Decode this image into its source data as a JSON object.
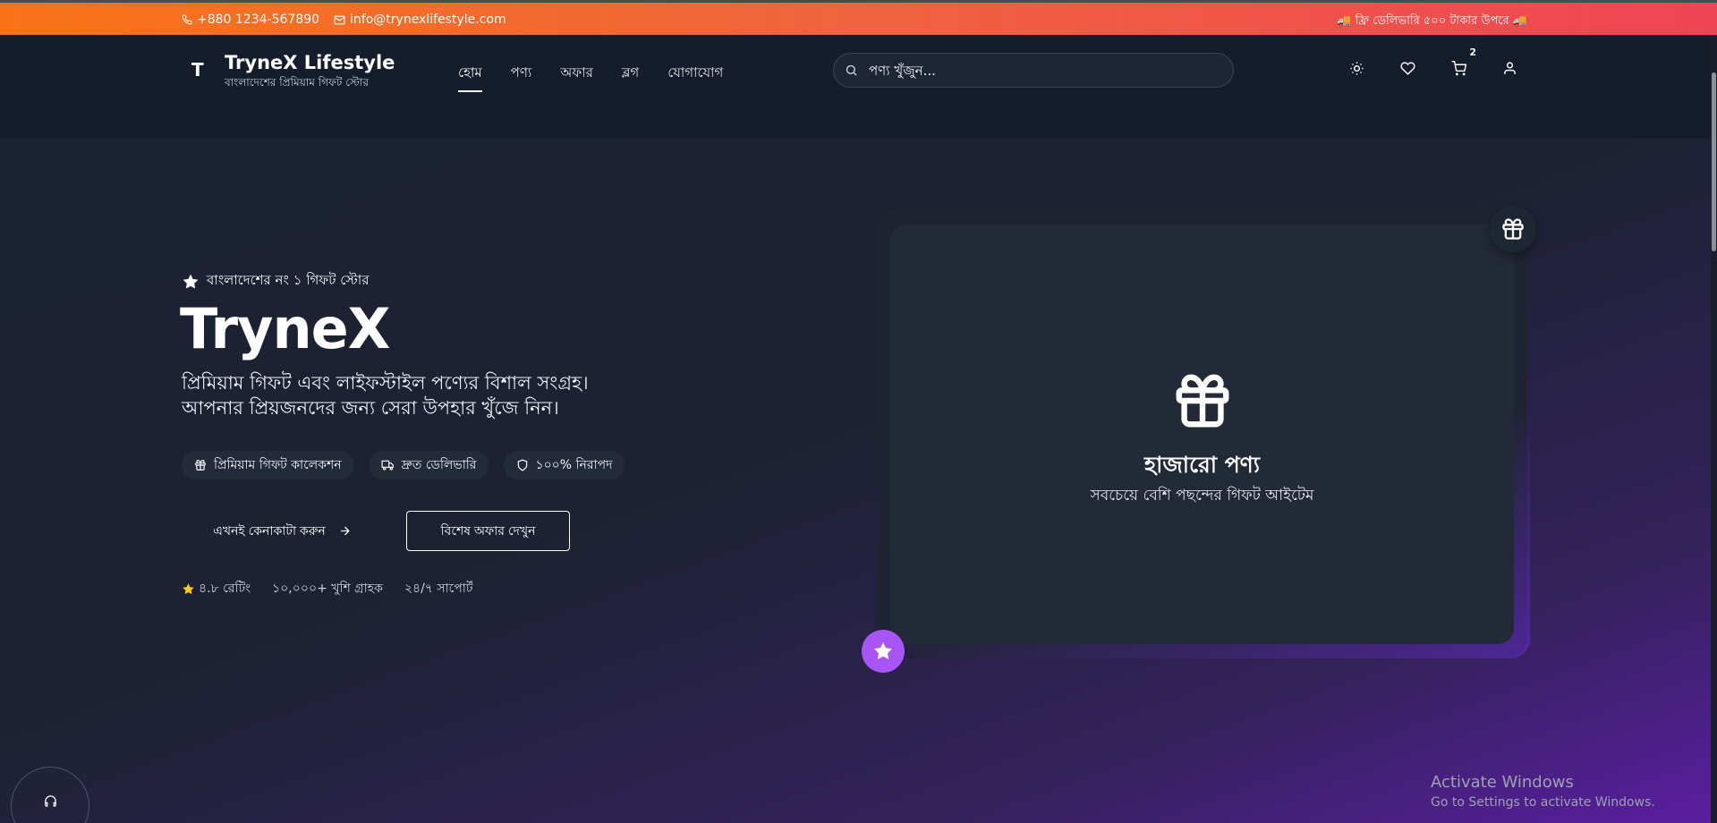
{
  "topbar": {
    "phone": "+880 1234-567890",
    "email": "info@trynexlifestyle.com",
    "promo": "🚚 ফ্রি ডেলিভারি ৫০০ টাকার উপরে 🚚"
  },
  "header": {
    "logo_letter": "T",
    "brand": "TryneX Lifestyle",
    "brand_sub": "বাংলাদেশের প্রিমিয়াম গিফট স্টোর",
    "nav": [
      "হোম",
      "পণ্য",
      "অফার",
      "ব্লগ",
      "যোগাযোগ"
    ],
    "search_placeholder": "পণ্য খুঁজুন...",
    "cart_count": "2"
  },
  "hero": {
    "tagline": "বাংলাদেশের নং ১ গিফট স্টোর",
    "title": "TryneX",
    "desc_line1": "প্রিমিয়াম গিফট এবং লাইফস্টাইল পণ্যের বিশাল সংগ্রহ।",
    "desc_line2": "আপনার প্রিয়জনদের জন্য সেরা উপহার খুঁজে নিন।",
    "chips": [
      "প্রিমিয়াম গিফট কালেকশন",
      "দ্রুত ডেলিভারি",
      "১০০% নিরাপদ"
    ],
    "cta_primary": "এখনই কেনাকাটা করুন",
    "cta_secondary": "বিশেষ অফার দেখুন",
    "stats": [
      "৪.৮ রেটিং",
      "১০,০০০+ খুশি গ্রাহক",
      "২৪/৭ সাপোর্ট"
    ]
  },
  "card": {
    "title": "হাজারো পণ্য",
    "subtitle": "সবচেয়ে বেশি পছন্দের গিফট আইটেম"
  },
  "watermark": {
    "line1": "Activate Windows",
    "line2": "Go to Settings to activate Windows."
  },
  "icons": [
    "phone-icon",
    "mail-icon",
    "search-icon",
    "sun-icon",
    "heart-icon",
    "cart-icon",
    "user-icon",
    "star-icon",
    "gift-icon",
    "truck-icon",
    "shield-icon",
    "arrow-right-icon",
    "headset-icon"
  ],
  "colors": {
    "topbar_start": "#f97316",
    "topbar_end": "#ef4454",
    "accent_purple": "#a855f7",
    "background": "#111827"
  }
}
